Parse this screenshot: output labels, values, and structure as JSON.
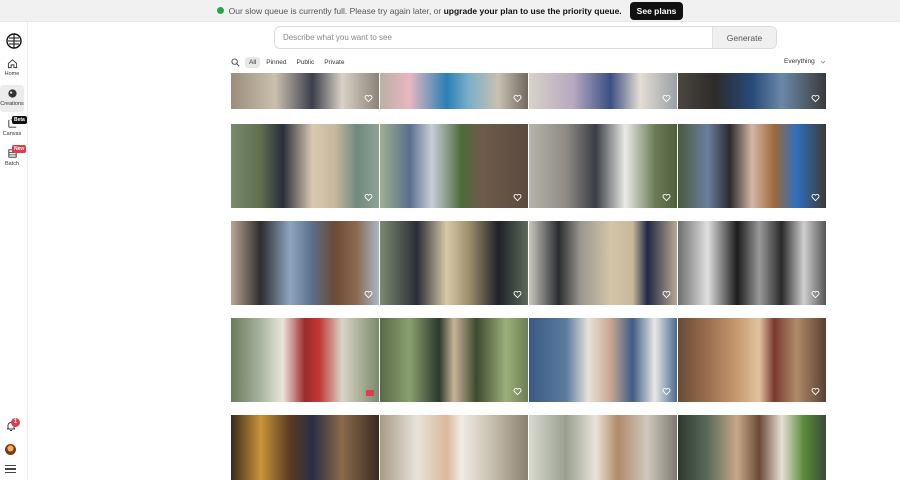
{
  "banner": {
    "text_before": "Our slow queue is currently full. Please try again later, or",
    "link_text": "upgrade your plan to use the priority queue.",
    "cta": "See plans"
  },
  "sidebar": {
    "items": [
      {
        "label": "Home",
        "icon": "home-icon"
      },
      {
        "label": "Creations",
        "icon": "creations-icon"
      },
      {
        "label": "Canvas",
        "icon": "canvas-icon",
        "badge": "Beta"
      },
      {
        "label": "Batch",
        "icon": "batch-icon",
        "badge": "New"
      }
    ],
    "notification_count": "1"
  },
  "search": {
    "placeholder": "Describe what you want to see",
    "button": "Generate"
  },
  "filters": {
    "tabs": [
      "All",
      "Pinned",
      "Public",
      "Private"
    ],
    "active_tab": "All",
    "scope": "Everything"
  },
  "gallery": {
    "rows": [
      [
        "photo-office-meeting",
        "photo-blue-dress-group",
        "photo-women-by-house",
        "photo-blue-folder-handoff"
      ],
      [
        "photo-men-on-sidewalk",
        "photo-man-by-tree",
        "photo-man-on-porch-fence",
        "photo-couple-at-door"
      ],
      [
        "photo-city-street-man",
        "photo-bench-conversation",
        "photo-men-at-building",
        "photo-bw-man-suit"
      ],
      [
        "photo-woman-red-coat",
        "photo-woman-camera",
        "photo-woman-on-phone",
        "photo-woman-tan-coat"
      ],
      [
        "photo-lamp-room",
        "photo-surprised-woman",
        "photo-woman-hallway",
        "photo-woman-door"
      ]
    ]
  },
  "colors": {
    "accent": "#e23b4a",
    "banner_bg": "#f1f1f2",
    "dark": "#111111"
  }
}
